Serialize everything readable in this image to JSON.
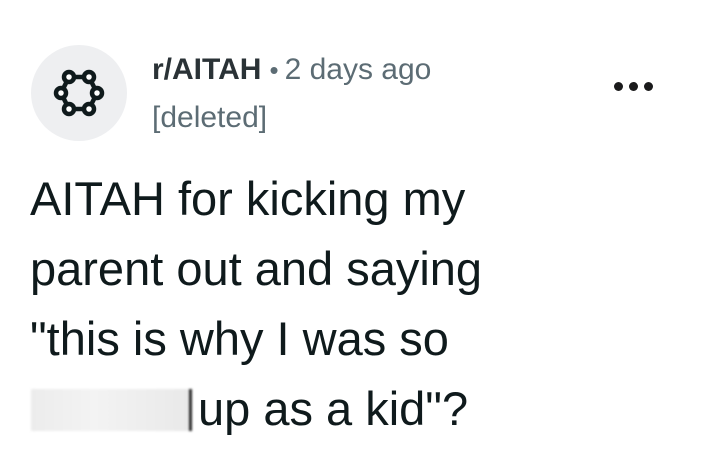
{
  "post": {
    "subreddit": "r/AITAH",
    "separator": "•",
    "time_ago": "2 days ago",
    "author": "[deleted]",
    "title_lines": [
      "AITAH for kicking my",
      "parent out and saying",
      "\"this is why I was so",
      "up as a kid\"?"
    ]
  },
  "icons": {
    "subreddit_avatar": "community-nodes-icon",
    "more_options": "more-options-icon"
  },
  "colors": {
    "avatar_bg": "#eeeff1",
    "meta_text": "#5c6c74",
    "title_text": "#0f1a1c"
  }
}
